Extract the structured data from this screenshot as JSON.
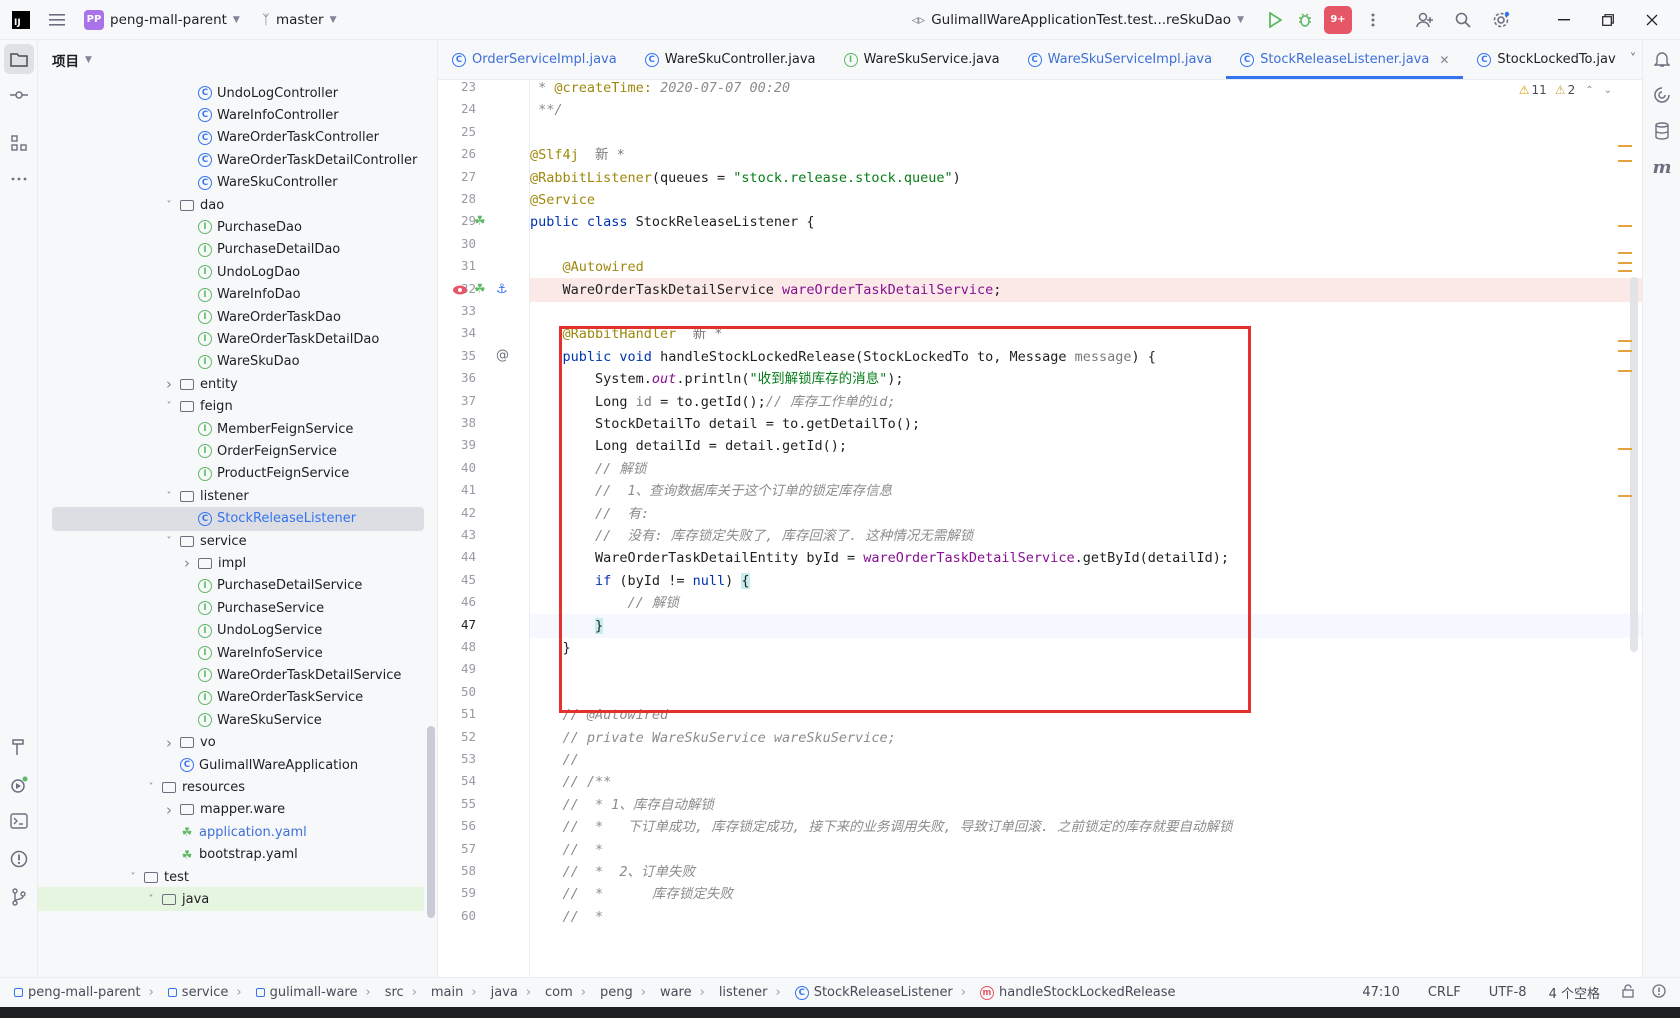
{
  "titlebar": {
    "ij": "IJ",
    "project_badge": "PP",
    "project_name": "peng-mall-parent",
    "branch": "master",
    "run_config": "GulimallWareApplicationTest.test...reSkuDao",
    "notif_badge": "9+"
  },
  "project_panel": {
    "title": "项目",
    "tree": [
      {
        "label": "UndoLogController",
        "icon": "class",
        "indent": 3,
        "chev": ""
      },
      {
        "label": "WareInfoController",
        "icon": "class",
        "indent": 3,
        "chev": ""
      },
      {
        "label": "WareOrderTaskController",
        "icon": "class",
        "indent": 3,
        "chev": ""
      },
      {
        "label": "WareOrderTaskDetailController",
        "icon": "class",
        "indent": 3,
        "chev": ""
      },
      {
        "label": "WareSkuController",
        "icon": "class",
        "indent": 3,
        "chev": ""
      },
      {
        "label": "dao",
        "icon": "package",
        "indent": 2,
        "chev": "down"
      },
      {
        "label": "PurchaseDao",
        "icon": "interface",
        "indent": 3,
        "chev": ""
      },
      {
        "label": "PurchaseDetailDao",
        "icon": "interface",
        "indent": 3,
        "chev": ""
      },
      {
        "label": "UndoLogDao",
        "icon": "interface",
        "indent": 3,
        "chev": ""
      },
      {
        "label": "WareInfoDao",
        "icon": "interface",
        "indent": 3,
        "chev": ""
      },
      {
        "label": "WareOrderTaskDao",
        "icon": "interface",
        "indent": 3,
        "chev": ""
      },
      {
        "label": "WareOrderTaskDetailDao",
        "icon": "interface",
        "indent": 3,
        "chev": ""
      },
      {
        "label": "WareSkuDao",
        "icon": "interface",
        "indent": 3,
        "chev": ""
      },
      {
        "label": "entity",
        "icon": "package",
        "indent": 2,
        "chev": "right"
      },
      {
        "label": "feign",
        "icon": "package",
        "indent": 2,
        "chev": "down"
      },
      {
        "label": "MemberFeignService",
        "icon": "interface",
        "indent": 3,
        "chev": ""
      },
      {
        "label": "OrderFeignService",
        "icon": "interface",
        "indent": 3,
        "chev": ""
      },
      {
        "label": "ProductFeignService",
        "icon": "interface",
        "indent": 3,
        "chev": ""
      },
      {
        "label": "listener",
        "icon": "package",
        "indent": 2,
        "chev": "down"
      },
      {
        "label": "StockReleaseListener",
        "icon": "class",
        "indent": 3,
        "chev": "",
        "selected": true
      },
      {
        "label": "service",
        "icon": "package",
        "indent": 2,
        "chev": "down"
      },
      {
        "label": "impl",
        "icon": "package",
        "indent": 3,
        "chev": "right"
      },
      {
        "label": "PurchaseDetailService",
        "icon": "interface",
        "indent": 3,
        "chev": ""
      },
      {
        "label": "PurchaseService",
        "icon": "interface",
        "indent": 3,
        "chev": ""
      },
      {
        "label": "UndoLogService",
        "icon": "interface",
        "indent": 3,
        "chev": ""
      },
      {
        "label": "WareInfoService",
        "icon": "interface",
        "indent": 3,
        "chev": ""
      },
      {
        "label": "WareOrderTaskDetailService",
        "icon": "interface",
        "indent": 3,
        "chev": ""
      },
      {
        "label": "WareOrderTaskService",
        "icon": "interface",
        "indent": 3,
        "chev": ""
      },
      {
        "label": "WareSkuService",
        "icon": "interface",
        "indent": 3,
        "chev": ""
      },
      {
        "label": "vo",
        "icon": "package",
        "indent": 2,
        "chev": "right"
      },
      {
        "label": "GulimallWareApplication",
        "icon": "app",
        "indent": 2,
        "chev": ""
      },
      {
        "label": "resources",
        "icon": "folder",
        "indent": 1,
        "chev": "down"
      },
      {
        "label": "mapper.ware",
        "icon": "folder",
        "indent": 2,
        "chev": "right"
      },
      {
        "label": "application.yaml",
        "icon": "yaml",
        "indent": 2,
        "chev": "",
        "blue": true
      },
      {
        "label": "bootstrap.yaml",
        "icon": "yaml",
        "indent": 2,
        "chev": ""
      },
      {
        "label": "test",
        "icon": "folder",
        "indent": 0,
        "chev": "down"
      },
      {
        "label": "java",
        "icon": "folder",
        "indent": 1,
        "chev": "down",
        "green": true
      }
    ]
  },
  "tabs": [
    {
      "label": "OrderServiceImpl.java",
      "icon": "class",
      "blue": true
    },
    {
      "label": "WareSkuController.java",
      "icon": "class",
      "blue": false
    },
    {
      "label": "WareSkuService.java",
      "icon": "interface",
      "blue": false
    },
    {
      "label": "WareSkuServiceImpl.java",
      "icon": "class",
      "blue": true
    },
    {
      "label": "StockReleaseListener.java",
      "icon": "class",
      "blue": true,
      "active": true
    },
    {
      "label": "StockLockedTo.jav",
      "icon": "class",
      "blue": false
    }
  ],
  "inspections": {
    "warnings": "11",
    "weak": "2"
  },
  "editor": {
    "first_line": 23,
    "current_line": 47,
    "lines": [
      [
        [
          "cmt",
          " * "
        ],
        [
          "ann",
          "@createTime:"
        ],
        [
          "cmt",
          " 2020-07-07 00:20"
        ]
      ],
      [
        [
          "cmt",
          " **/"
        ]
      ],
      [],
      [
        [
          "ann",
          "@Slf4j"
        ],
        [
          "par",
          "  新 *"
        ]
      ],
      [
        [
          "ann",
          "@RabbitListener"
        ],
        [
          "",
          "(queues = "
        ],
        [
          "str",
          "\"stock.release.stock.queue\""
        ],
        [
          "",
          ")"
        ]
      ],
      [
        [
          "ann",
          "@Service"
        ]
      ],
      [
        [
          "kw",
          "public class "
        ],
        [
          "",
          "StockReleaseListener {"
        ]
      ],
      [],
      [
        [
          "",
          "    "
        ],
        [
          "ann",
          "@Autowired"
        ]
      ],
      [
        [
          "",
          "    WareOrderTaskDetailService "
        ],
        [
          "fld",
          "wareOrderTaskDetailService"
        ],
        [
          "",
          ";"
        ]
      ],
      [],
      [
        [
          "",
          "    "
        ],
        [
          "ann",
          "@RabbitHandler"
        ],
        [
          "par",
          "  新 *"
        ]
      ],
      [
        [
          "",
          "    "
        ],
        [
          "kw",
          "public void "
        ],
        [
          "",
          "handleStockLockedRelease(StockLockedTo to, Message "
        ],
        [
          "par",
          "message"
        ],
        [
          "",
          ") {"
        ]
      ],
      [
        [
          "",
          "        System."
        ],
        [
          "st",
          "out"
        ],
        [
          "",
          ".println("
        ],
        [
          "str",
          "\"收到解锁库存的消息\""
        ],
        [
          "",
          ");"
        ]
      ],
      [
        [
          "",
          "        Long "
        ],
        [
          "par",
          "id"
        ],
        [
          "",
          " = to.getId();"
        ],
        [
          "cmt",
          "// 库存工作单的id;"
        ]
      ],
      [
        [
          "",
          "        StockDetailTo detail = to.getDetailTo();"
        ]
      ],
      [
        [
          "",
          "        Long detailId = detail.getId();"
        ]
      ],
      [
        [
          "",
          "        "
        ],
        [
          "cmt",
          "// 解锁"
        ]
      ],
      [
        [
          "",
          "        "
        ],
        [
          "cmt",
          "//  1、查询数据库关于这个订单的锁定库存信息"
        ]
      ],
      [
        [
          "",
          "        "
        ],
        [
          "cmt",
          "//  有:"
        ]
      ],
      [
        [
          "",
          "        "
        ],
        [
          "cmt",
          "//  没有: 库存锁定失败了, 库存回滚了. 这种情况无需解锁"
        ]
      ],
      [
        [
          "",
          "        WareOrderTaskDetailEntity byId = "
        ],
        [
          "fld",
          "wareOrderTaskDetailService"
        ],
        [
          "",
          ".getById(detailId);"
        ]
      ],
      [
        [
          "",
          "        "
        ],
        [
          "kw",
          "if "
        ],
        [
          "",
          "(byId != "
        ],
        [
          "kw",
          "null"
        ],
        [
          "",
          ") "
        ],
        [
          "hl",
          "{"
        ]
      ],
      [
        [
          "",
          "            "
        ],
        [
          "cmt",
          "// 解锁"
        ]
      ],
      [
        [
          "",
          "        "
        ],
        [
          "hl",
          "}"
        ]
      ],
      [
        [
          "",
          "    }"
        ]
      ],
      [],
      [],
      [
        [
          "",
          "    "
        ],
        [
          "cmt",
          "// @Autowired"
        ]
      ],
      [
        [
          "",
          "    "
        ],
        [
          "cmt",
          "// private WareSkuService wareSkuService;"
        ]
      ],
      [
        [
          "",
          "    "
        ],
        [
          "cmt",
          "//"
        ]
      ],
      [
        [
          "",
          "    "
        ],
        [
          "cmt",
          "// /**"
        ]
      ],
      [
        [
          "",
          "    "
        ],
        [
          "cmt",
          "//  * 1、库存自动解锁"
        ]
      ],
      [
        [
          "",
          "    "
        ],
        [
          "cmt",
          "//  *   下订单成功, 库存锁定成功, 接下来的业务调用失败, 导致订单回滚. 之前锁定的库存就要自动解锁"
        ]
      ],
      [
        [
          "",
          "    "
        ],
        [
          "cmt",
          "//  *"
        ]
      ],
      [
        [
          "",
          "    "
        ],
        [
          "cmt",
          "//  *  2、订单失败"
        ]
      ],
      [
        [
          "",
          "    "
        ],
        [
          "cmt",
          "//  *      库存锁定失败"
        ]
      ],
      [
        [
          "",
          "    "
        ],
        [
          "cmt",
          "//  *"
        ]
      ]
    ]
  },
  "statusbar": {
    "breadcrumbs": [
      "peng-mall-parent",
      "service",
      "gulimall-ware",
      "src",
      "main",
      "java",
      "com",
      "peng",
      "ware",
      "listener",
      "StockReleaseListener",
      "handleStockLockedRelease"
    ],
    "position": "47:10",
    "line_sep": "CRLF",
    "encoding": "UTF-8",
    "indent": "4 个空格"
  }
}
